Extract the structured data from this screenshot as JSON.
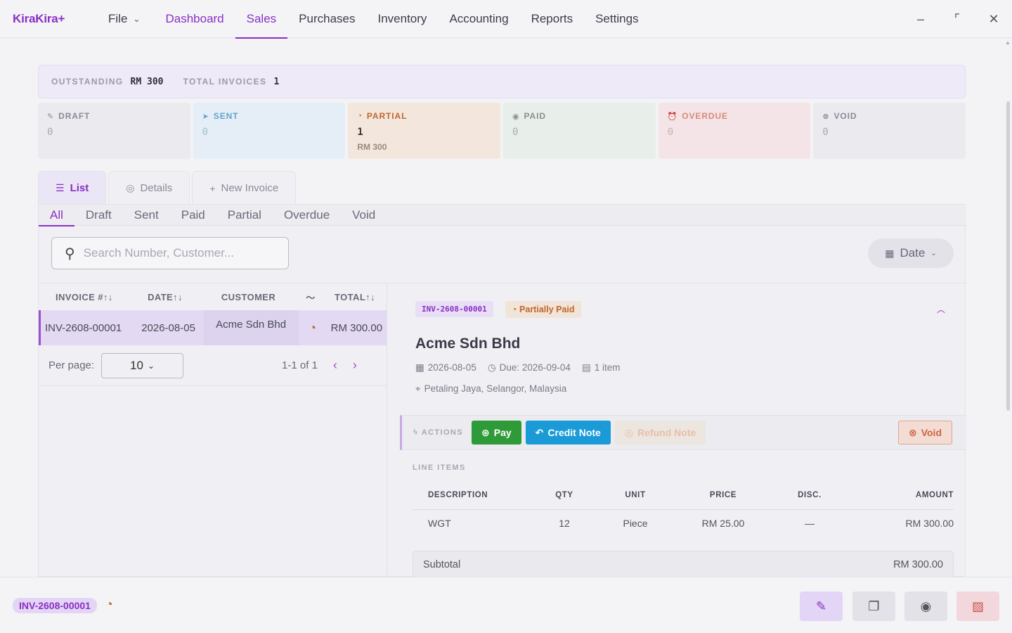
{
  "app": {
    "brand": "KiraKira+"
  },
  "nav": {
    "file": "File",
    "items": [
      "Dashboard",
      "Sales",
      "Purchases",
      "Inventory",
      "Accounting",
      "Reports",
      "Settings"
    ],
    "active": "Sales"
  },
  "window": {
    "minimize": "–",
    "restore": "⌜",
    "close": "✕"
  },
  "summary": {
    "outstanding_label": "OUTSTANDING",
    "outstanding_value": "RM 300",
    "total_label": "TOTAL INVOICES",
    "total_value": "1"
  },
  "status_cards": [
    {
      "label": "DRAFT",
      "count": "0",
      "icon": "✎"
    },
    {
      "label": "SENT",
      "count": "0",
      "icon": "➤"
    },
    {
      "label": "PARTIAL",
      "count": "1",
      "amount": "RM 300",
      "icon": "◔"
    },
    {
      "label": "PAID",
      "count": "0",
      "icon": "◉"
    },
    {
      "label": "OVERDUE",
      "count": "0",
      "icon": "⏰"
    },
    {
      "label": "VOID",
      "count": "0",
      "icon": "⊗"
    }
  ],
  "tabs": {
    "list": "List",
    "details": "Details",
    "new_invoice": "New Invoice"
  },
  "filters": [
    "All",
    "Draft",
    "Sent",
    "Paid",
    "Partial",
    "Overdue",
    "Void"
  ],
  "search": {
    "placeholder": "Search Number, Customer..."
  },
  "date_button": "Date",
  "table": {
    "headers": {
      "number": "INVOICE #↑↓",
      "date": "DATE↑↓",
      "customer": "CUSTOMER",
      "total": "TOTAL↑↓"
    },
    "rows": [
      {
        "number": "INV-2608-00001",
        "date": "2026-08-05",
        "customer": "Acme Sdn Bhd",
        "total": "RM 300.00"
      }
    ]
  },
  "pager": {
    "per_page_label": "Per page:",
    "per_page_value": "10",
    "range": "1-1 of 1"
  },
  "detail": {
    "invoice_no": "INV-2608-00001",
    "status": "Partially Paid",
    "customer": "Acme Sdn Bhd",
    "date": "2026-08-05",
    "due": "Due: 2026-09-04",
    "items_count": "1 item",
    "address": "Petaling Jaya, Selangor, Malaysia"
  },
  "actions": {
    "label": "ACTIONS",
    "pay": "Pay",
    "credit_note": "Credit Note",
    "refund_note": "Refund Note",
    "void": "Void"
  },
  "line_items": {
    "title": "LINE ITEMS",
    "headers": {
      "description": "DESCRIPTION",
      "qty": "QTY",
      "unit": "UNIT",
      "price": "PRICE",
      "disc": "DISC.",
      "amount": "AMOUNT"
    },
    "rows": [
      {
        "description": "WGT",
        "qty": "12",
        "unit": "Piece",
        "price": "RM 25.00",
        "disc": "—",
        "amount": "RM 300.00"
      }
    ]
  },
  "totals": {
    "subtotal_label": "Subtotal",
    "subtotal_value": "RM 300.00"
  },
  "footer": {
    "invoice_no": "INV-2608-00001"
  }
}
